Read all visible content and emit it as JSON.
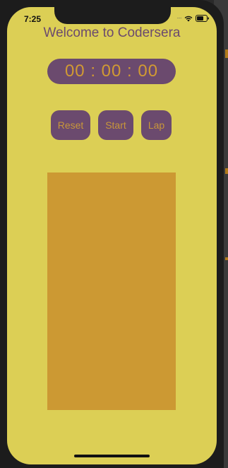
{
  "status_bar": {
    "time": "7:25",
    "wifi_icon": "wifi-icon",
    "battery_icon": "battery-icon"
  },
  "app": {
    "title": "Welcome to Codersera",
    "timer": "00 : 00 : 00"
  },
  "buttons": {
    "reset": "Reset",
    "start": "Start",
    "lap": "Lap"
  },
  "colors": {
    "background": "#dccf55",
    "accent": "#6b4a6e",
    "button_text": "#c8963a",
    "lap_panel": "#cc9933"
  }
}
